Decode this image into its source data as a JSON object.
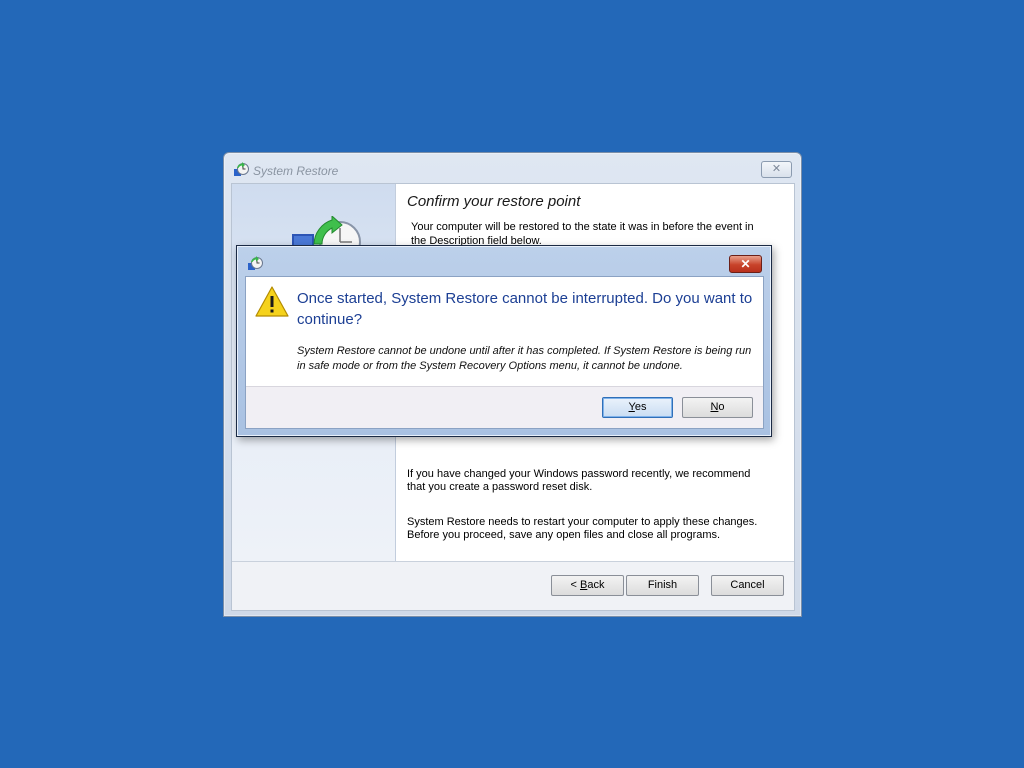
{
  "wizard": {
    "title": "System Restore",
    "close_glyph": "✕",
    "heading": "Confirm your restore point",
    "description": "Your computer will be restored to the state it was in before the event in the Description field below.",
    "password_note": "If you have changed your Windows password recently, we recommend that you create a password reset disk.",
    "restart_note": "System Restore needs to restart your computer to apply these changes. Before you proceed, save any open files and close all programs.",
    "buttons": {
      "back_prefix": "< ",
      "back_accel": "B",
      "back_rest": "ack",
      "finish": "Finish",
      "cancel": "Cancel"
    },
    "icons": {
      "title": "system-restore-icon",
      "graphic": "restore-clock-icon"
    }
  },
  "dialog": {
    "close_glyph": "✕",
    "main_instruction": "Once started, System Restore cannot be interrupted. Do you want to continue?",
    "detail": "System Restore cannot be undone until after it has completed. If System Restore is being run in safe mode or from the System Recovery Options menu, it cannot be undone.",
    "buttons": {
      "yes_accel": "Y",
      "yes_rest": "es",
      "no_accel": "N",
      "no_rest": "o"
    },
    "icons": {
      "title": "system-restore-icon",
      "warning": "warning-icon"
    }
  },
  "colors": {
    "desktop": "#2368b8",
    "main_instruction": "#1c3f94",
    "warning_fill": "#f5d21c",
    "close_button": "#c8432a"
  }
}
